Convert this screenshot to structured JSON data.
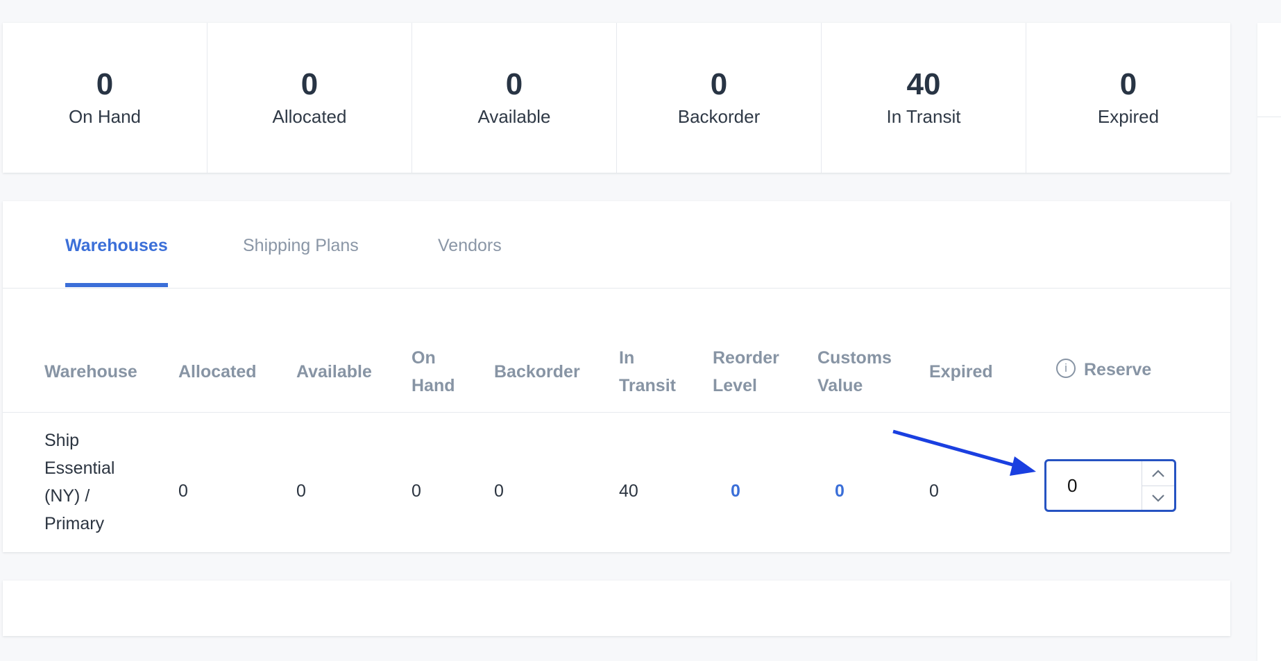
{
  "stats": [
    {
      "value": "0",
      "label": "On Hand"
    },
    {
      "value": "0",
      "label": "Allocated"
    },
    {
      "value": "0",
      "label": "Available"
    },
    {
      "value": "0",
      "label": "Backorder"
    },
    {
      "value": "40",
      "label": "In Transit"
    },
    {
      "value": "0",
      "label": "Expired"
    }
  ],
  "tabs": [
    {
      "label": "Warehouses",
      "active": true
    },
    {
      "label": "Shipping Plans",
      "active": false
    },
    {
      "label": "Vendors",
      "active": false
    }
  ],
  "table": {
    "headers": {
      "warehouse": "Warehouse",
      "allocated": "Allocated",
      "available": "Available",
      "on_hand_1": "On",
      "on_hand_2": "Hand",
      "backorder": "Backorder",
      "in_transit_1": "In",
      "in_transit_2": "Transit",
      "reorder_level_1": "Reorder",
      "reorder_level_2": "Level",
      "customs_value_1": "Customs",
      "customs_value_2": "Value",
      "expired": "Expired",
      "reserve": "Reserve",
      "reserve_info_icon": "i"
    },
    "row": {
      "warehouse_lines": [
        "Ship",
        "Essential",
        "(NY) /",
        "Primary"
      ],
      "allocated": "0",
      "available": "0",
      "on_hand": "0",
      "backorder": "0",
      "in_transit": "40",
      "reorder_level": "0",
      "customs_value": "0",
      "expired": "0",
      "reserve": "0"
    }
  },
  "icons": {
    "info": "info-circle-icon",
    "spin_up": "chevron-up-icon",
    "spin_down": "chevron-down-icon",
    "annotation": "annotation-arrow"
  },
  "colors": {
    "accent": "#3b6fd8",
    "stepper_border": "#2653c2",
    "arrow": "#1a3fe0"
  }
}
